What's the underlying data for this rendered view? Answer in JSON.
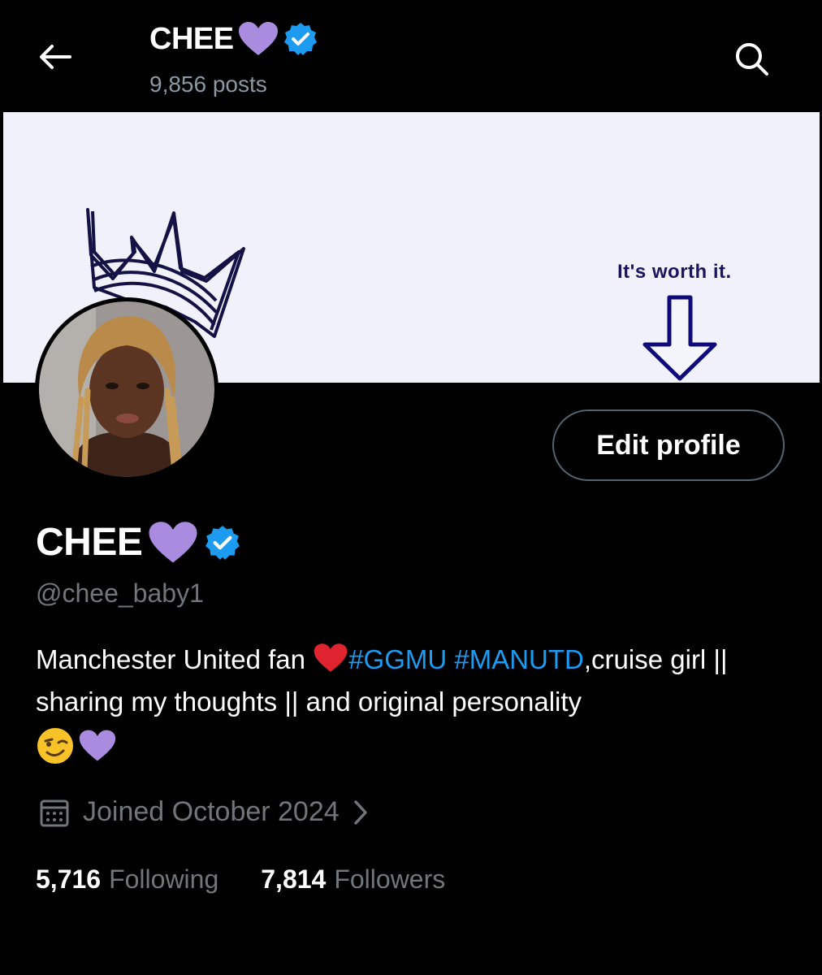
{
  "header": {
    "name": "CHEE",
    "posts_count": "9,856 posts"
  },
  "banner": {
    "tagline": "It's worth it."
  },
  "profile": {
    "display_name": "CHEE",
    "handle": "@chee_baby1",
    "edit_button_label": "Edit profile",
    "bio": {
      "part1": "Manchester United fan ",
      "hashtag1": "#GGMU",
      "space": " ",
      "hashtag2": "#MANUTD",
      "part2": ",cruise girl || sharing my thoughts || and original personality"
    },
    "joined": "Joined October 2024",
    "following_count": "5,716",
    "following_label": "Following",
    "followers_count": "7,814",
    "followers_label": "Followers"
  },
  "icons": {
    "back": "back-arrow-icon",
    "search": "search-icon",
    "verified": "verified-badge-icon",
    "heart": "purple-heart-icon",
    "calendar": "calendar-icon",
    "chevron": "chevron-right-icon"
  },
  "colors": {
    "accent": "#1d9bf0",
    "heart_purple": "#a98be0",
    "red_heart": "#e0242f",
    "muted": "#71767b",
    "background": "#000000"
  }
}
